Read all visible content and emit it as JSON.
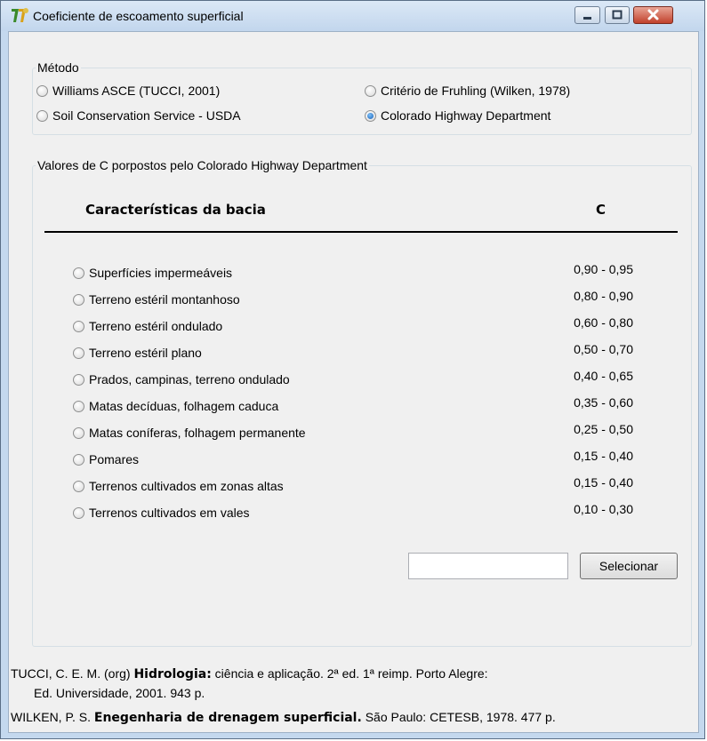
{
  "window": {
    "title": "Coeficiente de escoamento superficial"
  },
  "metodo": {
    "legend": "Método",
    "options": [
      {
        "label": "Williams ASCE (TUCCI, 2001)",
        "checked": false
      },
      {
        "label": "Critério de Fruhling (Wilken, 1978)",
        "checked": false
      },
      {
        "label": "Soil Conservation Service - USDA",
        "checked": false
      },
      {
        "label": "Colorado Highway Department",
        "checked": true
      }
    ]
  },
  "valores": {
    "legend": "Valores de C porpostos pelo Colorado Highway Department",
    "col_caracteristicas": "Características da bacia",
    "col_c": "C",
    "rows": [
      {
        "label": "Superfícies impermeáveis",
        "c": "0,90 - 0,95"
      },
      {
        "label": "Terreno estéril montanhoso",
        "c": "0,80 - 0,90"
      },
      {
        "label": "Terreno estéril ondulado",
        "c": "0,60 - 0,80"
      },
      {
        "label": "Terreno estéril plano",
        "c": "0,50 - 0,70"
      },
      {
        "label": "Prados, campinas, terreno ondulado",
        "c": "0,40 - 0,65"
      },
      {
        "label": "Matas decíduas, folhagem caduca",
        "c": "0,35 - 0,60"
      },
      {
        "label": "Matas coníferas, folhagem permanente",
        "c": "0,25 - 0,50"
      },
      {
        "label": "Pomares",
        "c": "0,15 - 0,40"
      },
      {
        "label": "Terrenos cultivados em zonas altas",
        "c": "0,15 - 0,40"
      },
      {
        "label": "Terrenos cultivados em vales",
        "c": "0,10 - 0,30"
      }
    ],
    "input_value": "",
    "select_button": "Selecionar"
  },
  "references": {
    "ref1_prefix": "TUCCI, C. E. M. (org) ",
    "ref1_bold": "Hidrologia:",
    "ref1_rest": "  ciência e aplicação. 2ª ed. 1ª reimp. Porto Alegre:",
    "ref1_line2": "Ed. Universidade, 2001. 943 p.",
    "ref2_prefix": "WILKEN, P. S. ",
    "ref2_bold": "Enegenharia de drenagem superficial.",
    "ref2_rest": "  São Paulo: CETESB, 1978. 477 p."
  },
  "icons": {
    "app": "app-logo-icon",
    "minimize": "minimize-icon",
    "maximize": "maximize-icon",
    "close": "close-icon"
  },
  "colors": {
    "titlebar": "#c2d6ed",
    "close_button": "#c1412b",
    "radio_checked": "#1460b8"
  }
}
